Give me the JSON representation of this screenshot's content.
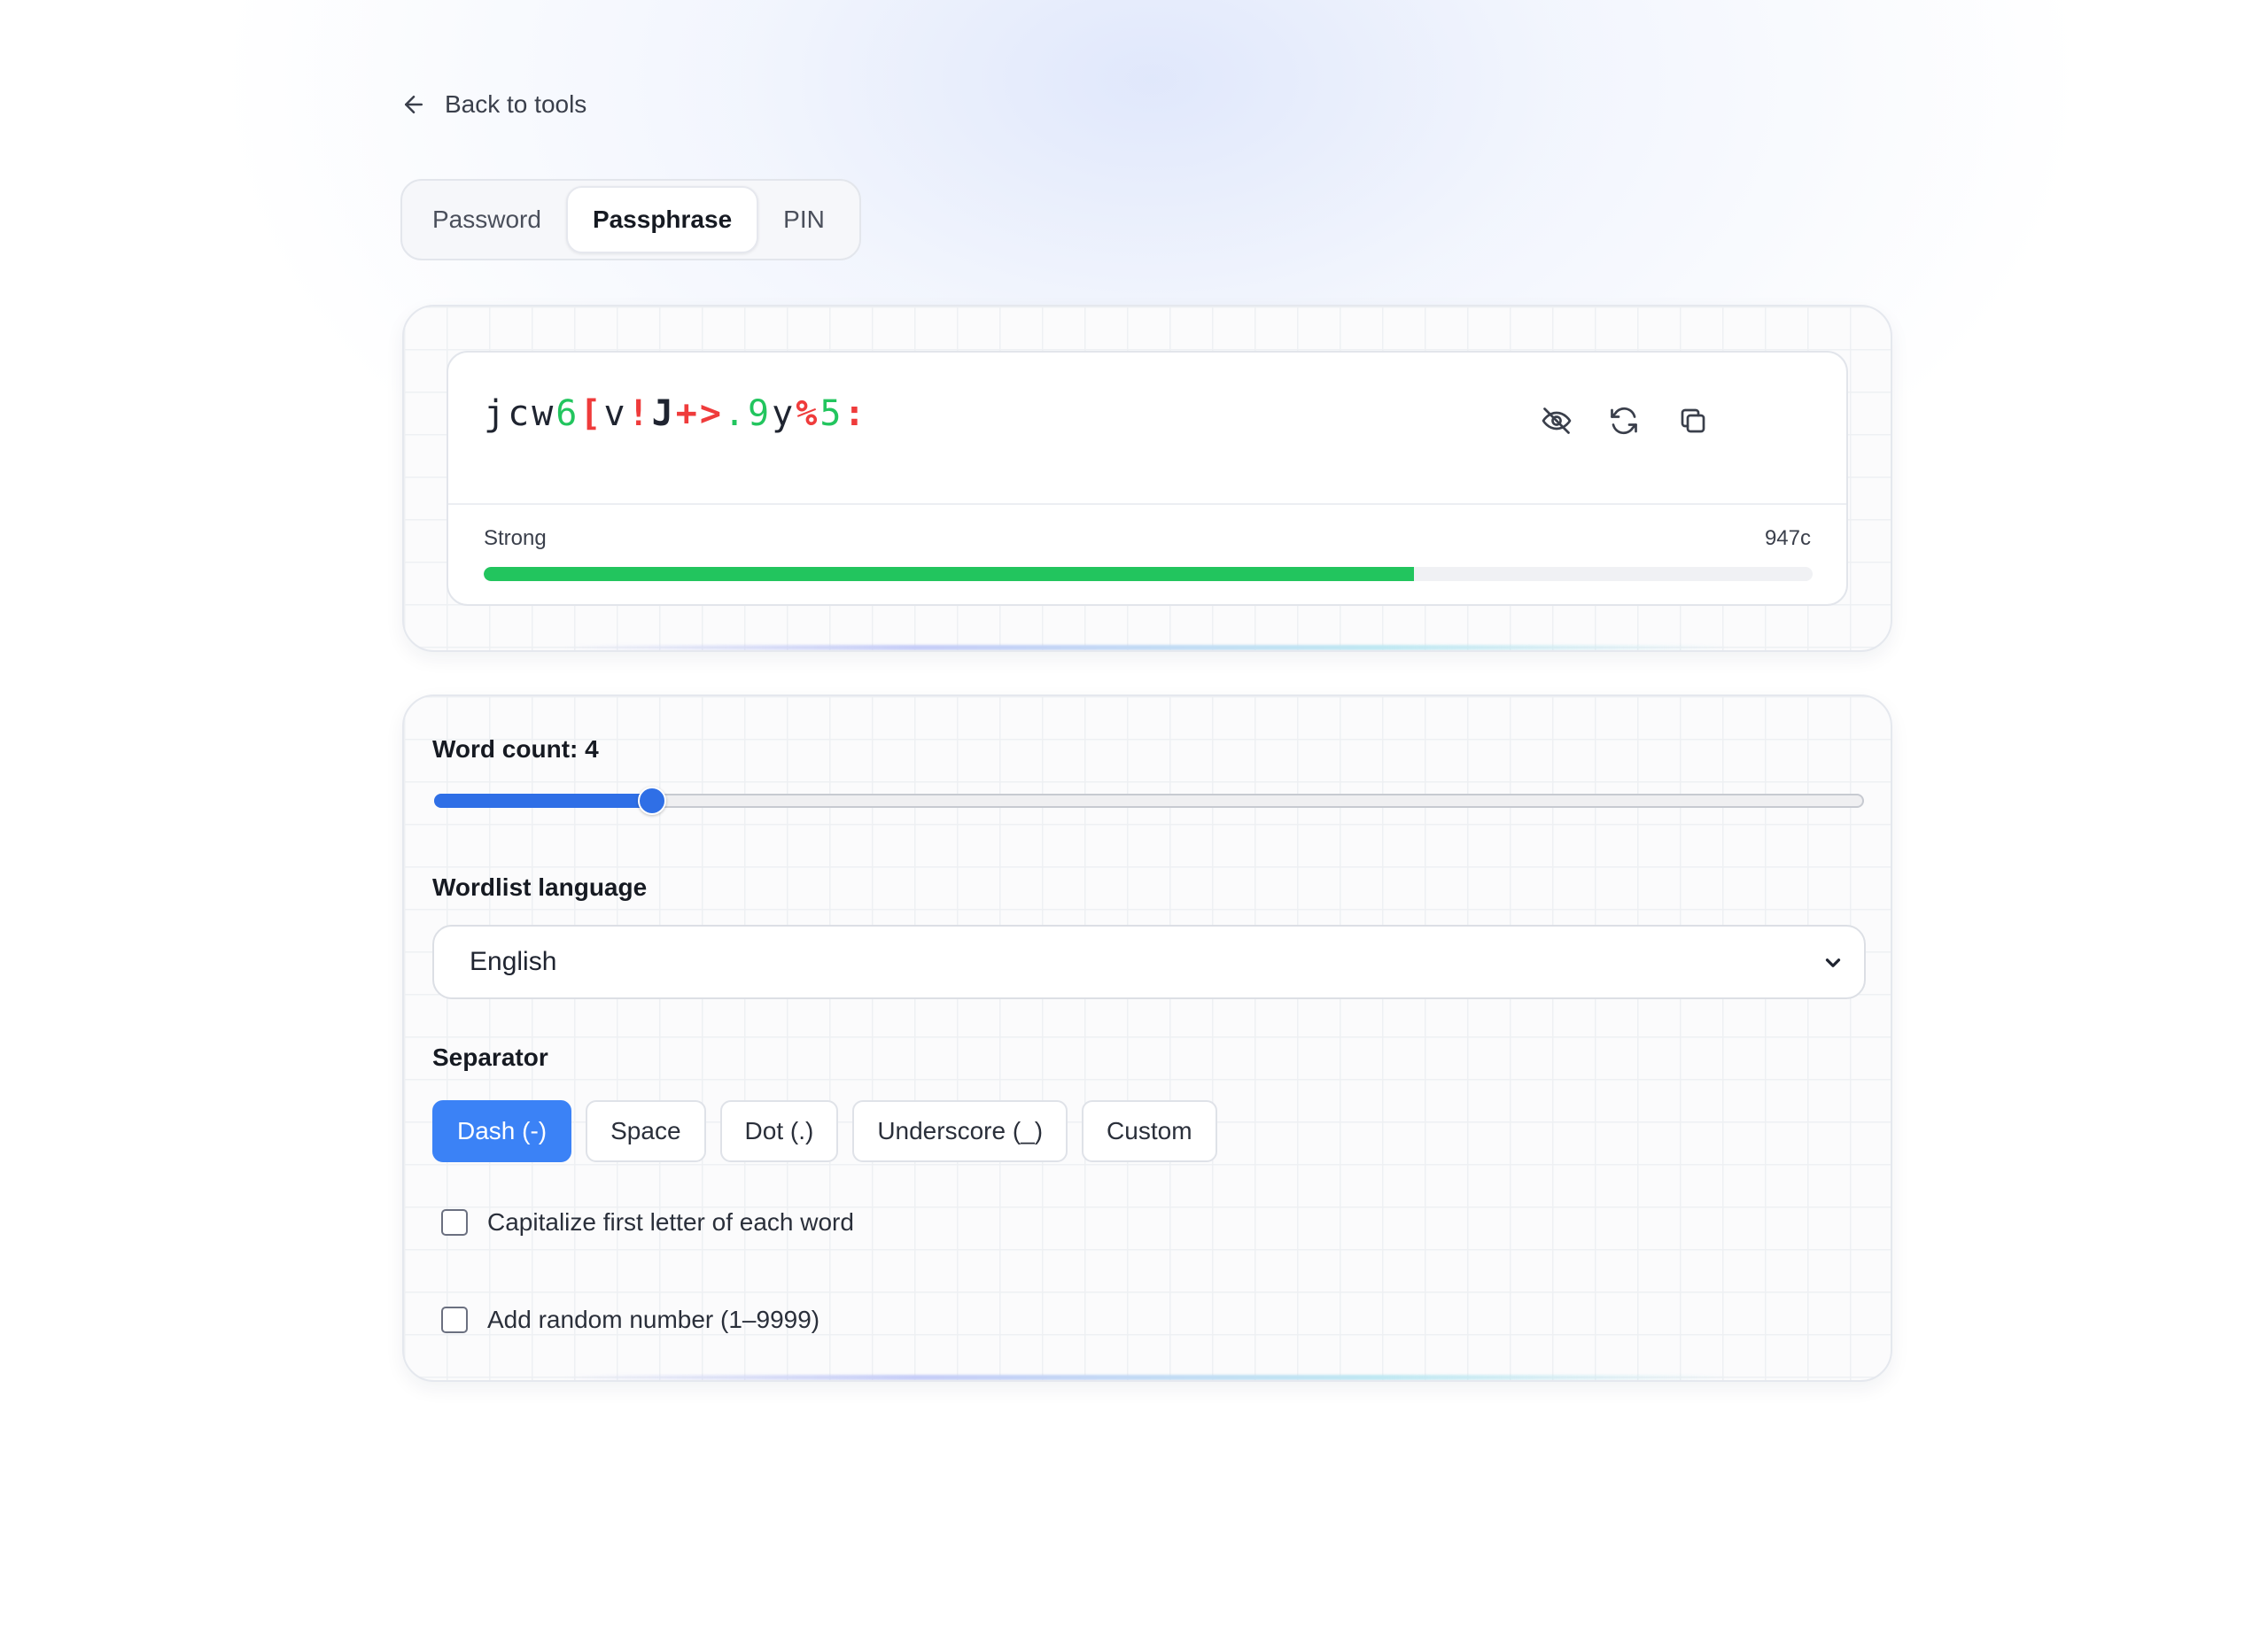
{
  "nav": {
    "back_label": "Back to tools"
  },
  "tabs": [
    {
      "label": "Password",
      "active": false
    },
    {
      "label": "Passphrase",
      "active": true
    },
    {
      "label": "PIN",
      "active": false
    }
  ],
  "output": {
    "password_chars": [
      {
        "ch": "j",
        "kind": "low"
      },
      {
        "ch": "c",
        "kind": "low"
      },
      {
        "ch": "w",
        "kind": "low"
      },
      {
        "ch": "6",
        "kind": "num"
      },
      {
        "ch": "[",
        "kind": "sym"
      },
      {
        "ch": "v",
        "kind": "low"
      },
      {
        "ch": "!",
        "kind": "sym"
      },
      {
        "ch": "J",
        "kind": "up"
      },
      {
        "ch": "+",
        "kind": "sym"
      },
      {
        "ch": ">",
        "kind": "sym"
      },
      {
        "ch": ".",
        "kind": "num"
      },
      {
        "ch": "9",
        "kind": "num"
      },
      {
        "ch": "y",
        "kind": "low"
      },
      {
        "ch": "%",
        "kind": "sym"
      },
      {
        "ch": "5",
        "kind": "num"
      },
      {
        "ch": ":",
        "kind": "sym"
      }
    ],
    "icons": [
      "eye-off-icon",
      "refresh-icon",
      "copy-icon"
    ],
    "strength_label": "Strong",
    "strength_value": "947c",
    "strength_fraction": 0.7,
    "colors": {
      "number": "#22c55e",
      "symbol": "#ef3b3b",
      "bar": "#22c55e"
    }
  },
  "settings": {
    "word_count_label": "Word count: 4",
    "word_count_value": 4,
    "wordlist_label": "Wordlist language",
    "wordlist_selected": "English",
    "separator_label": "Separator",
    "separators": [
      {
        "label": "Dash (-)",
        "active": true
      },
      {
        "label": "Space",
        "active": false
      },
      {
        "label": "Dot (.)",
        "active": false
      },
      {
        "label": "Underscore (_)",
        "active": false
      },
      {
        "label": "Custom",
        "active": false
      }
    ],
    "capitalize_label": "Capitalize first letter of each word",
    "capitalize_checked": false,
    "random_number_label": "Add random number (1–9999)",
    "random_number_checked": false,
    "accent_color": "#3b82f6"
  }
}
